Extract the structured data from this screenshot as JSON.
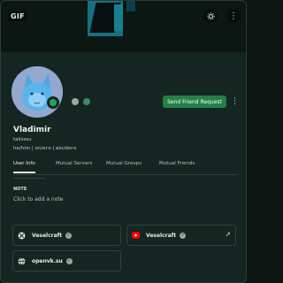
{
  "banner": {
    "gif_badge": "GIF"
  },
  "actions": {
    "send_friend_request": "Send Friend Request"
  },
  "profile": {
    "display_name": "Vladimir",
    "username": "tailsssu",
    "pronouns": "he/him | on/его | він/його"
  },
  "tabs": [
    {
      "label": "User Info",
      "active": true
    },
    {
      "label": "Mutual Servers",
      "active": false
    },
    {
      "label": "Mutual Groups",
      "active": false
    },
    {
      "label": "Mutual Friends",
      "active": false
    }
  ],
  "note": {
    "header": "NOTE",
    "placeholder": "Click to add a note"
  },
  "connections": [
    {
      "service": "xbox",
      "icon": "xbox-icon",
      "name": "Veselcraft"
    },
    {
      "service": "youtube",
      "icon": "youtube-icon",
      "name": "Veselcraft"
    },
    {
      "service": "website",
      "icon": "globe-icon",
      "name": "openvk.su"
    }
  ],
  "colors": {
    "background": "#152521",
    "friend_button": "#248046",
    "status_online": "#23a55a",
    "youtube_red": "#ff0000"
  }
}
